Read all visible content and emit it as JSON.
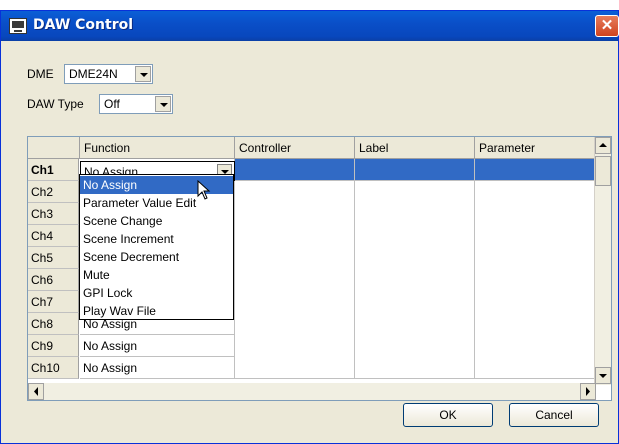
{
  "window": {
    "title": "DAW Control",
    "close_glyph": "✕"
  },
  "dme": {
    "label": "DME",
    "value": "DME24N"
  },
  "daw_type": {
    "label": "DAW Type",
    "value": "Off"
  },
  "grid": {
    "columns": [
      "Function",
      "Controller",
      "Label",
      "Parameter"
    ],
    "rows": [
      {
        "ch": "Ch1",
        "function": "No Assign"
      },
      {
        "ch": "Ch2",
        "function": ""
      },
      {
        "ch": "Ch3",
        "function": ""
      },
      {
        "ch": "Ch4",
        "function": ""
      },
      {
        "ch": "Ch5",
        "function": ""
      },
      {
        "ch": "Ch6",
        "function": ""
      },
      {
        "ch": "Ch7",
        "function": ""
      },
      {
        "ch": "Ch8",
        "function": "No Assign"
      },
      {
        "ch": "Ch9",
        "function": "No Assign"
      },
      {
        "ch": "Ch10",
        "function": "No Assign"
      }
    ]
  },
  "dropdown": {
    "options": [
      "No Assign",
      "Parameter Value Edit",
      "Scene Change",
      "Scene Increment",
      "Scene Decrement",
      "Mute",
      "GPI Lock",
      "Play Wav File"
    ],
    "highlighted": "No Assign"
  },
  "buttons": {
    "ok": "OK",
    "cancel": "Cancel"
  },
  "colors": {
    "selection": "#316ac5",
    "title_bar": "#0a4fc8",
    "dialog_bg": "#ece9d8"
  },
  "icons": {
    "title": "dme-device-icon",
    "close": "close-icon"
  }
}
